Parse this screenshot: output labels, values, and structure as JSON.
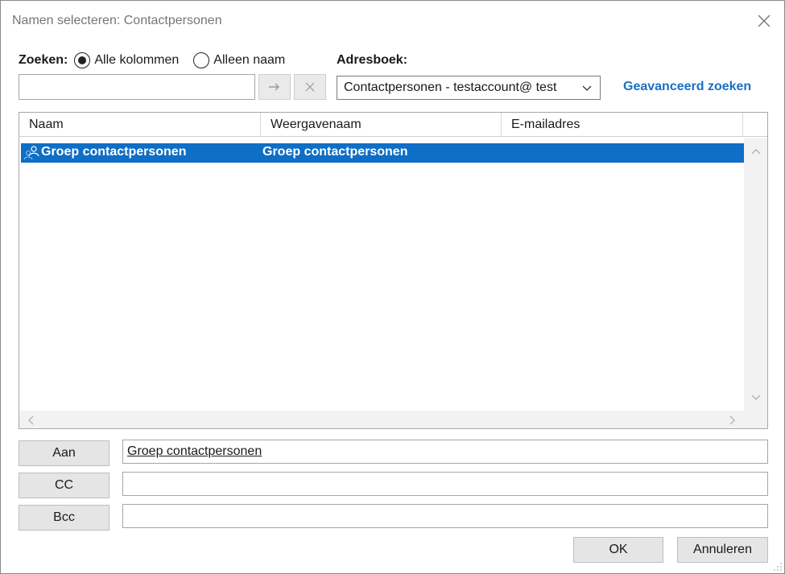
{
  "window": {
    "title": "Namen selecteren: Contactpersonen"
  },
  "search": {
    "label": "Zoeken:",
    "options": [
      {
        "label": "Alle kolommen",
        "selected": true
      },
      {
        "label": "Alleen naam",
        "selected": false
      }
    ],
    "query": "",
    "go_icon": "arrow-right-icon",
    "clear_icon": "close-icon"
  },
  "addressbook": {
    "label": "Adresboek:",
    "selected": "Contactpersonen - testaccount@ test",
    "advanced_link": "Geavanceerd zoeken"
  },
  "list": {
    "columns": [
      "Naam",
      "Weergavenaam",
      "E-mailadres"
    ],
    "rows": [
      {
        "icon": "contact-group-icon",
        "naam": "Groep contactpersonen",
        "weergavenaam": "Groep contactpersonen",
        "email": "",
        "selected": true
      }
    ]
  },
  "recipients": {
    "to": {
      "label": "Aan",
      "value": "Groep contactpersonen"
    },
    "cc": {
      "label": "CC",
      "value": ""
    },
    "bcc": {
      "label": "Bcc",
      "value": ""
    }
  },
  "buttons": {
    "ok": "OK",
    "cancel": "Annuleren"
  },
  "colors": {
    "selection": "#0f6ec5",
    "link": "#1a6fc4"
  }
}
